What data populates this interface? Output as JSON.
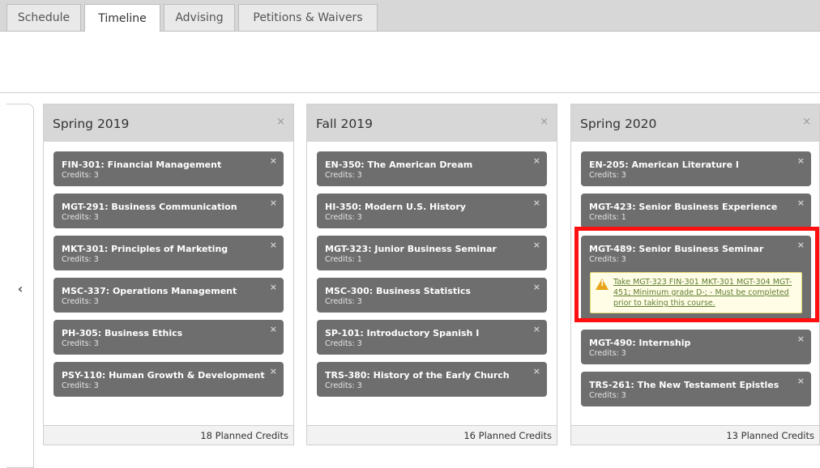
{
  "tabs": [
    {
      "label": "Schedule",
      "active": false
    },
    {
      "label": "Timeline",
      "active": true
    },
    {
      "label": "Advising",
      "active": false
    },
    {
      "label": "Petitions & Waivers",
      "active": false
    }
  ],
  "nav": {
    "prev_icon": "chevron-left-icon",
    "prev_glyph": "‹"
  },
  "close_glyph": "×",
  "warning_icon": "warning-triangle-icon",
  "columns": [
    {
      "term": "Spring 2019",
      "footer": "18 Planned Credits",
      "courses": [
        {
          "title": "FIN-301: Financial Management",
          "credits": "Credits: 3"
        },
        {
          "title": "MGT-291: Business Communication",
          "credits": "Credits: 3"
        },
        {
          "title": "MKT-301: Principles of Marketing",
          "credits": "Credits: 3"
        },
        {
          "title": "MSC-337: Operations Management",
          "credits": "Credits: 3"
        },
        {
          "title": "PH-305: Business Ethics",
          "credits": "Credits: 3"
        },
        {
          "title": "PSY-110: Human Growth & Development",
          "credits": "Credits: 3"
        }
      ]
    },
    {
      "term": "Fall 2019",
      "footer": "16 Planned Credits",
      "courses": [
        {
          "title": "EN-350: The American Dream",
          "credits": "Credits: 3"
        },
        {
          "title": "HI-350: Modern U.S. History",
          "credits": "Credits: 3"
        },
        {
          "title": "MGT-323: Junior Business Seminar",
          "credits": "Credits: 1"
        },
        {
          "title": "MSC-300: Business Statistics",
          "credits": "Credits: 3"
        },
        {
          "title": "SP-101: Introductory Spanish I",
          "credits": "Credits: 3"
        },
        {
          "title": "TRS-380: History of the Early Church",
          "credits": "Credits: 3"
        }
      ]
    },
    {
      "term": "Spring 2020",
      "footer": "13 Planned Credits",
      "courses": [
        {
          "title": "EN-205: American Literature I",
          "credits": "Credits: 3"
        },
        {
          "title": "MGT-423: Senior Business Experience",
          "credits": "Credits: 1"
        },
        {
          "title": "MGT-489: Senior Business Seminar",
          "credits": "Credits: 3",
          "warning": "Take MGT-323 FIN-301 MKT-301 MGT-304 MGT-451; Minimum grade D-; - Must be completed prior to taking this course."
        },
        {
          "title": "MGT-490: Internship",
          "credits": "Credits: 3"
        },
        {
          "title": "TRS-261: The New Testament Epistles",
          "credits": "Credits: 3"
        }
      ]
    }
  ],
  "colors": {
    "tabbar": "#d7d7d7",
    "card": "#6e6e6e",
    "warning_bg": "#fffde6",
    "warning_text": "#5f7d32",
    "highlight": "#ff1010"
  }
}
